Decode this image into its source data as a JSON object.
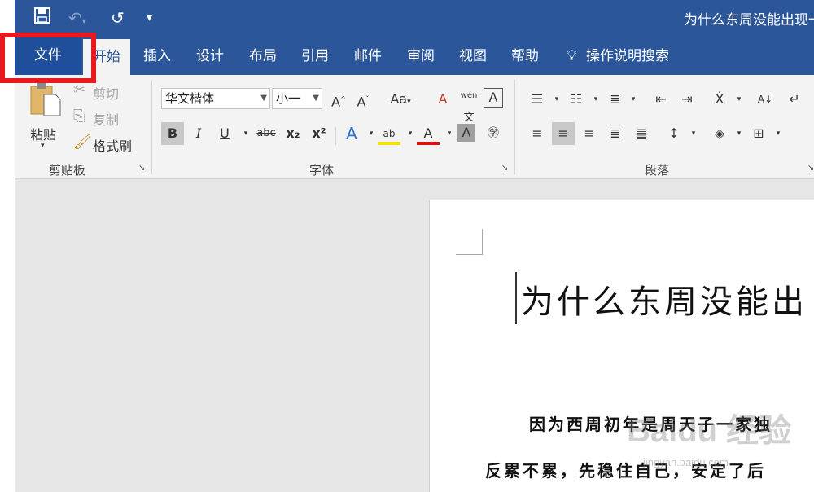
{
  "title_bar": {
    "save_icon": "save-icon",
    "undo_icon": "undo-icon",
    "redo_icon": "redo-icon",
    "customize_icon": "customize-qat-icon",
    "document_title": "为什么东周没能出现一"
  },
  "tabs": {
    "file": "文件",
    "home": "开始",
    "insert": "插入",
    "design": "设计",
    "layout": "布局",
    "references": "引用",
    "mailings": "邮件",
    "review": "审阅",
    "view": "视图",
    "help": "帮助",
    "tell_me": "操作说明搜索"
  },
  "clipboard": {
    "paste": "粘贴",
    "cut": "剪切",
    "copy": "复制",
    "format_painter": "格式刷",
    "group_label": "剪贴板"
  },
  "font": {
    "font_name": "华文楷体",
    "font_size": "小一",
    "group_label": "字体",
    "bold": "B",
    "italic": "I",
    "underline": "U",
    "strike": "abc",
    "subscript": "x₂",
    "superscript": "x²",
    "phonetic": "wén",
    "change_case": "Aa"
  },
  "paragraph": {
    "group_label": "段落"
  },
  "document": {
    "heading": "为什么东周没能出",
    "line1": "因为西周初年是周天子一家独",
    "line2": "反累不累，先稳住自己，安定了后"
  },
  "watermark": {
    "brand": "Baidu 经验",
    "url": "jingyan.baidu.com"
  },
  "colors": {
    "ribbon_blue": "#2b579a",
    "highlight_red": "#e8191f"
  }
}
